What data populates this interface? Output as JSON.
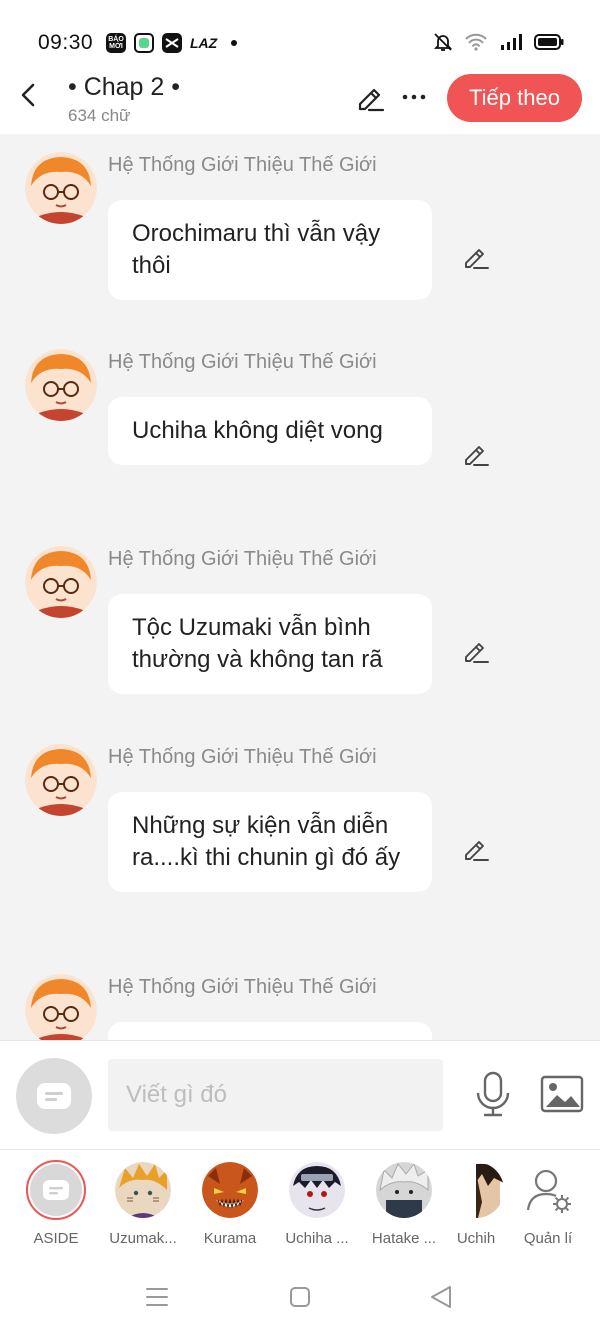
{
  "status_bar": {
    "time": "09:30",
    "apps": [
      "BÁO MỚI",
      "app-green",
      "CapCut",
      "LAZ"
    ]
  },
  "header": {
    "title": "• Chap 2 •",
    "word_count": "634 chữ",
    "next_button": "Tiếp theo"
  },
  "messages": [
    {
      "sender": "Hệ Thống Giới Thiệu Thế Giới",
      "text": "Orochimaru thì vẫn vậy thôi"
    },
    {
      "sender": "Hệ Thống Giới Thiệu Thế Giới",
      "text": "Uchiha không diệt vong"
    },
    {
      "sender": "Hệ Thống Giới Thiệu Thế Giới",
      "text": "Tộc Uzumaki vẫn bình thường và không tan rã"
    },
    {
      "sender": "Hệ Thống Giới Thiệu Thế Giới",
      "text": "Những sự kiện vẫn diễn ra....kì thi chunin gì đó ấy"
    },
    {
      "sender": "Hệ Thống Giới Thiệu Thế Giới",
      "text": ""
    }
  ],
  "input": {
    "placeholder": "Viết gì đó"
  },
  "characters": [
    {
      "label": "ASIDE",
      "selected": true
    },
    {
      "label": "Uzumak..."
    },
    {
      "label": "Kurama"
    },
    {
      "label": "Uchiha ..."
    },
    {
      "label": "Hatake ..."
    },
    {
      "label": "Uchih"
    },
    {
      "label": "Quản lí"
    }
  ],
  "colors": {
    "accent": "#f05454",
    "background": "#f3f3f3",
    "bubble": "#ffffff",
    "sender_text": "#8a8a8a"
  }
}
